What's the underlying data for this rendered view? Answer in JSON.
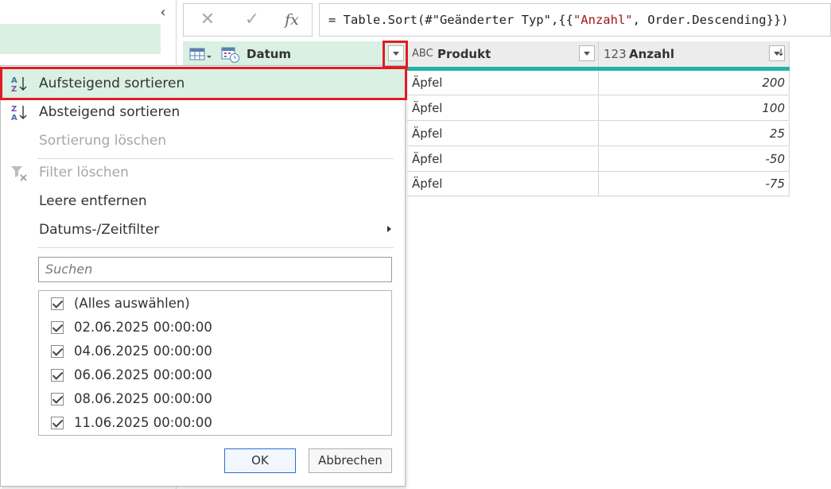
{
  "formula_bar": {
    "cancel_symbol": "✕",
    "confirm_symbol": "✓",
    "fx_label": "fx",
    "formula_prefix": "= Table.Sort(#\"Geänderter Typ\",{{",
    "formula_string": "\"Anzahl\"",
    "formula_suffix": ", Order.Descending}})"
  },
  "columns": [
    {
      "name": "Datum",
      "type_icon": "date-time"
    },
    {
      "name": "Produkt",
      "type_icon": "ABC"
    },
    {
      "name": "Anzahl",
      "type_icon": "123"
    }
  ],
  "type_labels": {
    "produkt": "ABC",
    "anzahl": "123"
  },
  "rows": [
    {
      "produkt": "Äpfel",
      "anzahl": "200"
    },
    {
      "produkt": "Äpfel",
      "anzahl": "100"
    },
    {
      "produkt": "Äpfel",
      "anzahl": "25"
    },
    {
      "produkt": "Äpfel",
      "anzahl": "-50"
    },
    {
      "produkt": "Äpfel",
      "anzahl": "-75"
    }
  ],
  "menu": {
    "sort_asc": "Aufsteigend sortieren",
    "sort_desc": "Absteigend sortieren",
    "clear_sort": "Sortierung löschen",
    "clear_filter": "Filter löschen",
    "remove_empty": "Leere entfernen",
    "datetime_filter": "Datums-/Zeitfilter",
    "search_placeholder": "Suchen",
    "items": [
      "(Alles auswählen)",
      "02.06.2025 00:00:00",
      "04.06.2025 00:00:00",
      "06.06.2025 00:00:00",
      "08.06.2025 00:00:00",
      "11.06.2025 00:00:00"
    ],
    "ok_label": "OK",
    "cancel_label": "Abbrechen"
  },
  "colors": {
    "accent_green": "#d9f0e3",
    "teal": "#1fb5a3",
    "highlight_red": "#e21c24",
    "primary_button_border": "#2b6fd0"
  }
}
